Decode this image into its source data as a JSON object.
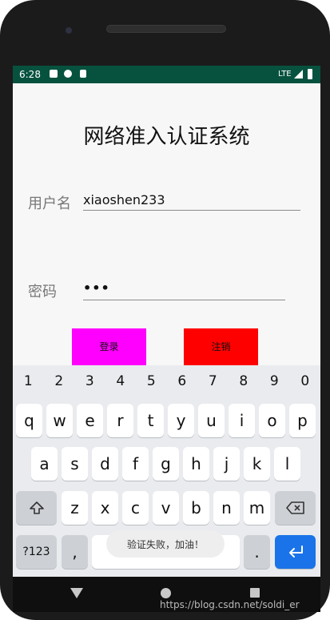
{
  "status": {
    "time": "6:28",
    "network": "LTE"
  },
  "app": {
    "title": "网络准入认证系统",
    "username_label": "用户名",
    "username_value": "xiaoshen233",
    "password_label": "密码",
    "password_value": "•••",
    "login_label": "登录",
    "cancel_label": "注销",
    "colors": {
      "login": "#ff00ff",
      "cancel": "#ff0000",
      "status_bar": "#06523f",
      "enter_key": "#1a73e8"
    }
  },
  "keyboard": {
    "digits": [
      "1",
      "2",
      "3",
      "4",
      "5",
      "6",
      "7",
      "8",
      "9",
      "0"
    ],
    "row1": [
      "q",
      "w",
      "e",
      "r",
      "t",
      "y",
      "u",
      "i",
      "o",
      "p"
    ],
    "row2": [
      "a",
      "s",
      "d",
      "f",
      "g",
      "h",
      "j",
      "k",
      "l"
    ],
    "row3": [
      "z",
      "x",
      "c",
      "v",
      "b",
      "n",
      "m"
    ],
    "shift_icon": "shift-icon",
    "backspace_icon": "backspace-icon",
    "symbols_label": "?123",
    "comma": ",",
    "period": ".",
    "enter_icon": "enter-icon"
  },
  "toast": {
    "text": "验证失败，加油！"
  },
  "watermark": "https://blog.csdn.net/soldi_er"
}
